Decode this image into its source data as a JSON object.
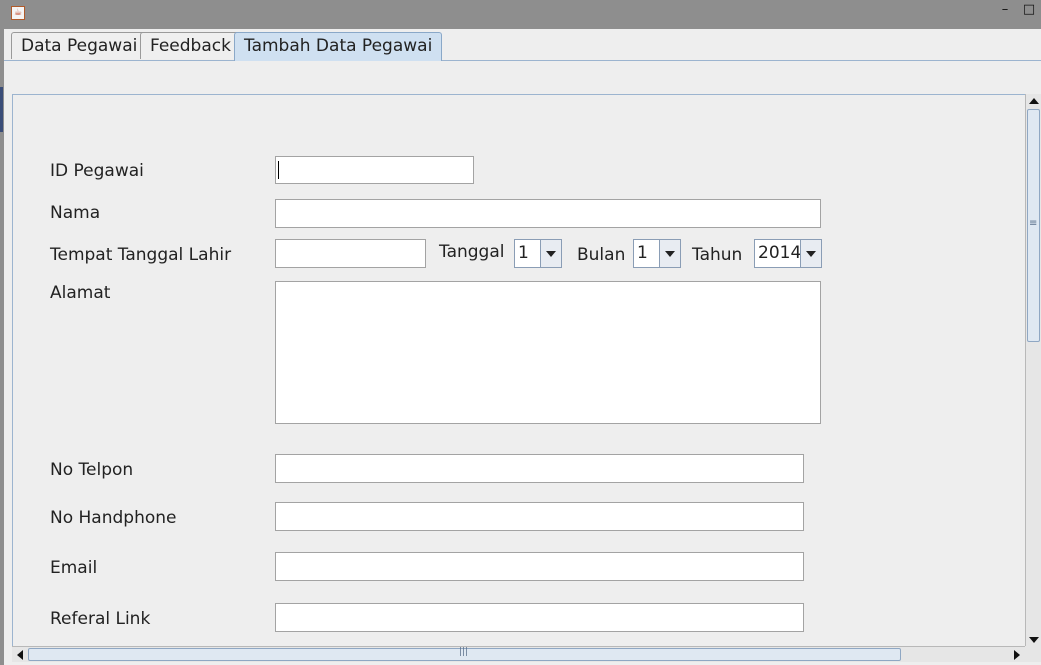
{
  "window": {
    "app_icon": "java-cup-icon",
    "minimize_label": "–",
    "maximize_label": "□"
  },
  "tabs": [
    {
      "label": "Data Pegawai",
      "active": false
    },
    {
      "label": "Feedback",
      "active": false
    },
    {
      "label": "Tambah Data Pegawai",
      "active": true
    }
  ],
  "form": {
    "id_label": "ID Pegawai",
    "id_value": "",
    "nama_label": "Nama",
    "nama_value": "",
    "ttl_label": "Tempat Tanggal Lahir",
    "tempat_value": "",
    "tanggal_label": "Tanggal",
    "tanggal_value": "1",
    "bulan_label": "Bulan",
    "bulan_value": "1",
    "tahun_label": "Tahun",
    "tahun_value": "2014",
    "alamat_label": "Alamat",
    "alamat_value": "",
    "telpon_label": "No Telpon",
    "telpon_value": "",
    "handphone_label": "No Handphone",
    "handphone_value": "",
    "email_label": "Email",
    "email_value": "",
    "referal_label": "Referal Link",
    "referal_value": ""
  },
  "colors": {
    "active_tab": "#cfe0f1",
    "window_frame": "#8e8e8e",
    "panel_bg": "#eeeeee"
  }
}
